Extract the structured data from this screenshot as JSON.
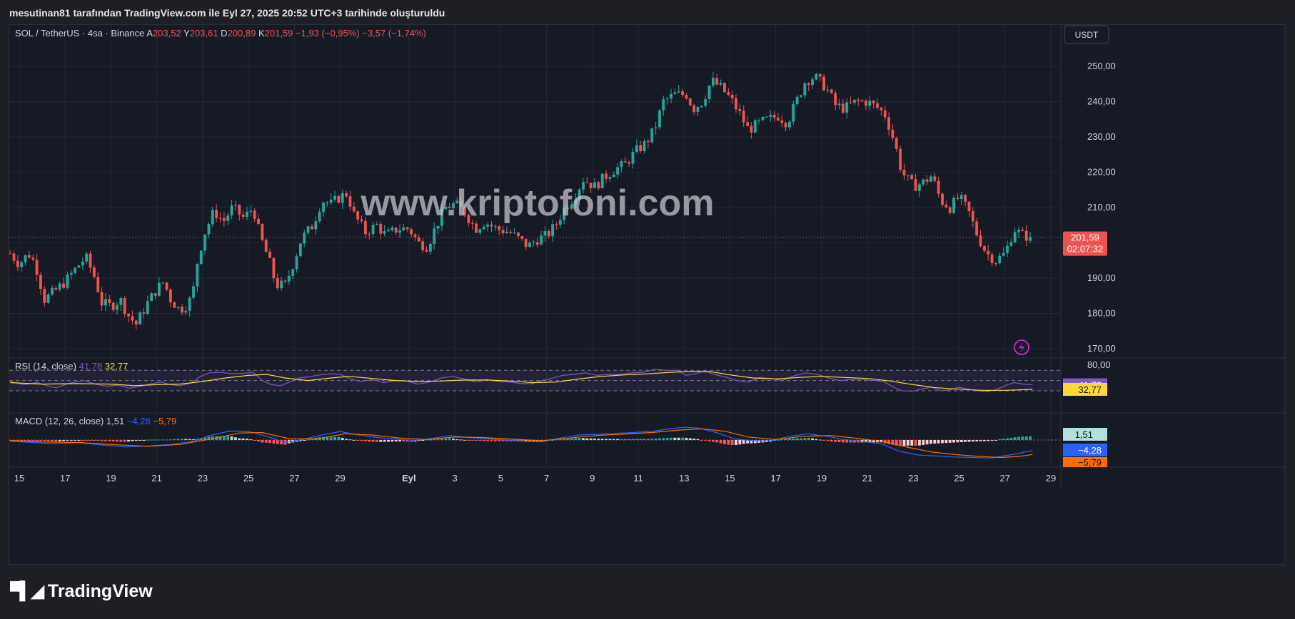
{
  "header": {
    "credit": "mesutinan81 tarafından TradingView.com ile Eyl 27, 2025 20:52 UTC+3 tarihinde oluşturuldu"
  },
  "legend": {
    "symbol": "SOL / TetherUS · 4sa · Binance",
    "open_label": "A",
    "open": "203,52",
    "high_label": "Y",
    "high": "203,61",
    "low_label": "D",
    "low": "200,89",
    "close_label": "K",
    "close": "201,59",
    "change": "−1,93 (−0,95%)",
    "change2": "−3,57 (−1,74%)"
  },
  "currency_button": "USDT",
  "price_label": {
    "value": "201,59",
    "countdown": "02:07:32"
  },
  "watermark": "www.kriptofoni.com",
  "rsi": {
    "label": "RSI (14, close)",
    "value": "41,78",
    "ma": "32,77",
    "scale_top": "80,00",
    "tag_value": "41,78",
    "tag_ma": "32,77"
  },
  "macd": {
    "label": "MACD (12, 26, close)",
    "hist": "1,51",
    "macd": "−4,28",
    "signal": "−5,79",
    "tag_hist": "1,51",
    "tag_macd": "−4,28",
    "tag_signal": "−5,79"
  },
  "footer": {
    "brand": "TradingView",
    "logo_icon": "tradingview-logo-icon"
  },
  "colors": {
    "up": "#26a69a",
    "down": "#ef5350",
    "bg": "#161a25",
    "rsi": "#7e57c2",
    "rsi_ma": "#fdd835",
    "macd": "#2962ff",
    "signal": "#ff6d00",
    "hist_up_strong": "#26a69a",
    "hist_up_weak": "#b2dfdb",
    "hist_down_strong": "#ff5252",
    "hist_down_weak": "#ffcdd2"
  },
  "chart_data": {
    "type": "candlestick",
    "price_axis": {
      "min": 165,
      "max": 255,
      "ticks": [
        "250,00",
        "240,00",
        "230,00",
        "220,00",
        "210,00",
        "190,00",
        "180,00",
        "170,00"
      ],
      "tick_values": [
        250,
        240,
        230,
        220,
        210,
        190,
        180,
        170
      ]
    },
    "x_ticks": [
      "15",
      "17",
      "19",
      "21",
      "23",
      "25",
      "27",
      "29",
      "Eyl",
      "3",
      "5",
      "7",
      "9",
      "11",
      "13",
      "15",
      "17",
      "19",
      "21",
      "23",
      "25",
      "27",
      "29"
    ],
    "x_tick_days": [
      15,
      17,
      19,
      21,
      23,
      25,
      27,
      29,
      32,
      34,
      36,
      38,
      40,
      42,
      44,
      46,
      48,
      50,
      52,
      54,
      56,
      58,
      60
    ],
    "day_start": 14.6,
    "candles_per_day": 6,
    "last_price": 201.59,
    "price_path": [
      [
        14.6,
        197
      ],
      [
        15.0,
        194
      ],
      [
        15.4,
        197
      ],
      [
        15.7,
        194
      ],
      [
        16.1,
        184
      ],
      [
        16.5,
        186
      ],
      [
        17.0,
        189
      ],
      [
        17.5,
        193
      ],
      [
        17.9,
        196
      ],
      [
        18.3,
        190
      ],
      [
        18.6,
        183
      ],
      [
        19.0,
        182
      ],
      [
        19.4,
        184
      ],
      [
        19.8,
        179
      ],
      [
        20.1,
        177
      ],
      [
        20.6,
        183
      ],
      [
        21.0,
        187
      ],
      [
        21.3,
        189
      ],
      [
        21.6,
        184
      ],
      [
        22.0,
        181
      ],
      [
        22.4,
        183
      ],
      [
        22.6,
        187
      ],
      [
        22.8,
        196
      ],
      [
        23.1,
        203
      ],
      [
        23.5,
        209
      ],
      [
        23.9,
        206
      ],
      [
        24.3,
        210
      ],
      [
        24.8,
        207
      ],
      [
        25.2,
        210
      ],
      [
        25.5,
        202
      ],
      [
        25.9,
        195
      ],
      [
        26.2,
        188
      ],
      [
        26.6,
        188
      ],
      [
        27.0,
        195
      ],
      [
        27.3,
        201
      ],
      [
        27.8,
        205
      ],
      [
        28.2,
        212
      ],
      [
        28.6,
        211
      ],
      [
        29.0,
        213
      ],
      [
        29.3,
        214
      ],
      [
        29.6,
        208
      ],
      [
        30.1,
        203
      ],
      [
        30.6,
        205
      ],
      [
        31.0,
        202
      ],
      [
        31.5,
        204
      ],
      [
        32.0,
        204
      ],
      [
        32.4,
        200
      ],
      [
        32.8,
        199
      ],
      [
        33.2,
        205
      ],
      [
        33.6,
        210
      ],
      [
        34.0,
        211
      ],
      [
        34.4,
        209
      ],
      [
        34.9,
        204
      ],
      [
        35.3,
        206
      ],
      [
        35.8,
        204
      ],
      [
        36.4,
        203
      ],
      [
        36.8,
        201
      ],
      [
        37.2,
        199
      ],
      [
        37.6,
        201
      ],
      [
        38.0,
        202
      ],
      [
        38.4,
        205
      ],
      [
        38.8,
        210
      ],
      [
        39.2,
        213
      ],
      [
        39.6,
        218
      ],
      [
        40.1,
        216
      ],
      [
        40.6,
        219
      ],
      [
        41.0,
        221
      ],
      [
        41.4,
        222
      ],
      [
        41.9,
        226
      ],
      [
        42.3,
        228
      ],
      [
        42.7,
        232
      ],
      [
        43.1,
        240
      ],
      [
        43.6,
        242
      ],
      [
        44.1,
        242
      ],
      [
        44.4,
        238
      ],
      [
        44.8,
        240
      ],
      [
        45.2,
        246
      ],
      [
        45.6,
        244
      ],
      [
        46.0,
        241
      ],
      [
        46.4,
        237
      ],
      [
        46.8,
        232
      ],
      [
        47.3,
        234
      ],
      [
        47.7,
        235
      ],
      [
        48.1,
        236
      ],
      [
        48.5,
        234
      ],
      [
        48.9,
        240
      ],
      [
        49.3,
        246
      ],
      [
        49.7,
        247
      ],
      [
        50.2,
        244
      ],
      [
        50.6,
        239
      ],
      [
        51.0,
        238
      ],
      [
        51.5,
        240
      ],
      [
        52.0,
        240
      ],
      [
        52.5,
        238
      ],
      [
        52.8,
        236
      ],
      [
        53.2,
        228
      ],
      [
        53.5,
        220
      ],
      [
        54.0,
        216
      ],
      [
        54.4,
        217
      ],
      [
        54.8,
        219
      ],
      [
        55.2,
        212
      ],
      [
        55.6,
        210
      ],
      [
        56.0,
        213
      ],
      [
        56.4,
        209
      ],
      [
        56.8,
        202
      ],
      [
        57.2,
        197
      ],
      [
        57.6,
        195
      ],
      [
        58.0,
        197
      ],
      [
        58.4,
        204
      ],
      [
        58.8,
        202
      ],
      [
        59.2,
        201.59
      ]
    ],
    "rsi_axis": {
      "min": 20,
      "max": 85,
      "levels": [
        70,
        50,
        30
      ]
    },
    "rsi_series": [
      [
        14.6,
        48
      ],
      [
        15.2,
        42
      ],
      [
        15.8,
        46
      ],
      [
        16.2,
        40
      ],
      [
        16.6,
        36
      ],
      [
        17.2,
        45
      ],
      [
        17.8,
        50
      ],
      [
        18.3,
        43
      ],
      [
        18.8,
        39
      ],
      [
        19.3,
        41
      ],
      [
        19.8,
        35
      ],
      [
        20.3,
        39
      ],
      [
        20.8,
        44
      ],
      [
        21.2,
        47
      ],
      [
        21.6,
        42
      ],
      [
        22.0,
        40
      ],
      [
        22.5,
        45
      ],
      [
        22.9,
        58
      ],
      [
        23.3,
        65
      ],
      [
        23.8,
        66
      ],
      [
        24.3,
        63
      ],
      [
        24.8,
        64
      ],
      [
        25.2,
        66
      ],
      [
        25.6,
        50
      ],
      [
        26.0,
        42
      ],
      [
        26.4,
        40
      ],
      [
        26.8,
        47
      ],
      [
        27.2,
        55
      ],
      [
        27.6,
        57
      ],
      [
        28.1,
        61
      ],
      [
        28.6,
        63
      ],
      [
        29.0,
        62
      ],
      [
        29.4,
        54
      ],
      [
        29.9,
        48
      ],
      [
        30.4,
        52
      ],
      [
        30.9,
        46
      ],
      [
        31.4,
        50
      ],
      [
        31.9,
        49
      ],
      [
        32.4,
        43
      ],
      [
        32.9,
        47
      ],
      [
        33.4,
        55
      ],
      [
        33.9,
        58
      ],
      [
        34.4,
        53
      ],
      [
        34.9,
        47
      ],
      [
        35.4,
        52
      ],
      [
        35.9,
        48
      ],
      [
        36.4,
        47
      ],
      [
        36.9,
        44
      ],
      [
        37.4,
        44
      ],
      [
        37.8,
        50
      ],
      [
        38.2,
        54
      ],
      [
        38.7,
        60
      ],
      [
        39.2,
        62
      ],
      [
        39.7,
        65
      ],
      [
        40.2,
        60
      ],
      [
        40.7,
        62
      ],
      [
        41.2,
        62
      ],
      [
        41.7,
        65
      ],
      [
        42.2,
        66
      ],
      [
        42.7,
        72
      ],
      [
        43.2,
        70
      ],
      [
        43.7,
        70
      ],
      [
        44.1,
        60
      ],
      [
        44.5,
        63
      ],
      [
        44.9,
        69
      ],
      [
        45.3,
        62
      ],
      [
        45.8,
        57
      ],
      [
        46.3,
        50
      ],
      [
        46.8,
        47
      ],
      [
        47.3,
        56
      ],
      [
        47.8,
        54
      ],
      [
        48.3,
        50
      ],
      [
        48.8,
        59
      ],
      [
        49.3,
        65
      ],
      [
        49.8,
        62
      ],
      [
        50.3,
        55
      ],
      [
        50.8,
        50
      ],
      [
        51.3,
        52
      ],
      [
        51.8,
        52
      ],
      [
        52.3,
        50
      ],
      [
        52.7,
        48
      ],
      [
        53.1,
        38
      ],
      [
        53.5,
        30
      ],
      [
        54.0,
        29
      ],
      [
        54.4,
        34
      ],
      [
        54.8,
        37
      ],
      [
        55.2,
        30
      ],
      [
        55.6,
        32
      ],
      [
        56.0,
        37
      ],
      [
        56.4,
        33
      ],
      [
        56.8,
        30
      ],
      [
        57.2,
        28
      ],
      [
        57.6,
        32
      ],
      [
        58.0,
        40
      ],
      [
        58.4,
        46
      ],
      [
        58.8,
        43
      ],
      [
        59.2,
        41.78
      ]
    ],
    "rsi_ma_series": [
      [
        14.6,
        46
      ],
      [
        16.0,
        43
      ],
      [
        17.5,
        44
      ],
      [
        19.0,
        43
      ],
      [
        20.0,
        40
      ],
      [
        21.0,
        42
      ],
      [
        22.0,
        43
      ],
      [
        23.0,
        48
      ],
      [
        24.0,
        55
      ],
      [
        25.0,
        60
      ],
      [
        25.8,
        62
      ],
      [
        26.6,
        55
      ],
      [
        27.6,
        50
      ],
      [
        28.6,
        55
      ],
      [
        29.4,
        58
      ],
      [
        30.4,
        54
      ],
      [
        31.4,
        50
      ],
      [
        32.4,
        48
      ],
      [
        33.4,
        49
      ],
      [
        34.4,
        51
      ],
      [
        35.4,
        51
      ],
      [
        36.4,
        49
      ],
      [
        37.4,
        46
      ],
      [
        38.4,
        47
      ],
      [
        39.4,
        53
      ],
      [
        40.4,
        58
      ],
      [
        41.4,
        61
      ],
      [
        42.4,
        63
      ],
      [
        43.4,
        66
      ],
      [
        44.4,
        68
      ],
      [
        45.2,
        67
      ],
      [
        46.0,
        61
      ],
      [
        47.0,
        55
      ],
      [
        48.0,
        53
      ],
      [
        49.0,
        56
      ],
      [
        50.0,
        58
      ],
      [
        51.0,
        56
      ],
      [
        52.0,
        54
      ],
      [
        53.0,
        49
      ],
      [
        54.0,
        42
      ],
      [
        55.0,
        36
      ],
      [
        56.0,
        33
      ],
      [
        57.0,
        31
      ],
      [
        58.0,
        31
      ],
      [
        59.2,
        32.77
      ]
    ],
    "macd_axis": {
      "min": -8,
      "max": 6
    },
    "macd_series": [
      [
        14.6,
        -0.5
      ],
      [
        15.6,
        -1.0
      ],
      [
        16.6,
        -1.5
      ],
      [
        17.6,
        -1.0
      ],
      [
        18.6,
        -2.0
      ],
      [
        19.6,
        -2.8
      ],
      [
        20.6,
        -2.4
      ],
      [
        21.6,
        -1.8
      ],
      [
        22.6,
        -0.5
      ],
      [
        23.4,
        2.0
      ],
      [
        24.2,
        3.6
      ],
      [
        25.0,
        3.4
      ],
      [
        25.8,
        1.5
      ],
      [
        26.6,
        -1.0
      ],
      [
        27.4,
        0.3
      ],
      [
        28.2,
        2.0
      ],
      [
        29.0,
        3.4
      ],
      [
        29.8,
        2.0
      ],
      [
        30.6,
        1.0
      ],
      [
        31.4,
        0.4
      ],
      [
        32.2,
        -0.2
      ],
      [
        33.0,
        0.6
      ],
      [
        33.8,
        1.8
      ],
      [
        34.6,
        1.0
      ],
      [
        35.4,
        0.5
      ],
      [
        36.2,
        0.0
      ],
      [
        37.0,
        -0.5
      ],
      [
        37.8,
        -0.8
      ],
      [
        38.6,
        0.8
      ],
      [
        39.4,
        2.0
      ],
      [
        40.2,
        2.3
      ],
      [
        41.0,
        2.6
      ],
      [
        41.8,
        3.0
      ],
      [
        42.6,
        3.5
      ],
      [
        43.4,
        4.6
      ],
      [
        44.0,
        5.1
      ],
      [
        44.6,
        4.8
      ],
      [
        45.4,
        3.0
      ],
      [
        46.2,
        0.5
      ],
      [
        47.0,
        -0.3
      ],
      [
        47.8,
        -0.3
      ],
      [
        48.6,
        1.5
      ],
      [
        49.4,
        2.5
      ],
      [
        50.2,
        1.5
      ],
      [
        51.0,
        0.2
      ],
      [
        51.8,
        -0.6
      ],
      [
        52.6,
        -1.5
      ],
      [
        53.4,
        -4.5
      ],
      [
        54.2,
        -6.0
      ],
      [
        55.0,
        -6.4
      ],
      [
        55.8,
        -6.8
      ],
      [
        56.6,
        -7.0
      ],
      [
        57.4,
        -7.2
      ],
      [
        58.2,
        -6.0
      ],
      [
        59.2,
        -4.28
      ]
    ],
    "signal_series": [
      [
        14.6,
        -0.2
      ],
      [
        16.0,
        -0.8
      ],
      [
        17.6,
        -1.0
      ],
      [
        19.0,
        -1.8
      ],
      [
        20.6,
        -2.5
      ],
      [
        22.0,
        -1.8
      ],
      [
        23.4,
        0.5
      ],
      [
        24.6,
        2.8
      ],
      [
        25.6,
        3.0
      ],
      [
        26.8,
        0.5
      ],
      [
        28.0,
        0.5
      ],
      [
        29.2,
        2.5
      ],
      [
        30.4,
        2.0
      ],
      [
        31.6,
        0.8
      ],
      [
        32.8,
        0.2
      ],
      [
        34.0,
        1.2
      ],
      [
        35.2,
        1.0
      ],
      [
        36.4,
        0.4
      ],
      [
        37.8,
        -0.3
      ],
      [
        39.0,
        0.8
      ],
      [
        40.2,
        1.8
      ],
      [
        41.4,
        2.4
      ],
      [
        42.6,
        3.0
      ],
      [
        43.8,
        4.0
      ],
      [
        44.8,
        4.5
      ],
      [
        45.8,
        3.5
      ],
      [
        46.8,
        1.2
      ],
      [
        48.0,
        0.2
      ],
      [
        49.2,
        1.5
      ],
      [
        50.4,
        1.8
      ],
      [
        51.6,
        0.6
      ],
      [
        52.8,
        -0.8
      ],
      [
        53.8,
        -3.0
      ],
      [
        54.8,
        -4.8
      ],
      [
        55.8,
        -5.8
      ],
      [
        56.8,
        -6.5
      ],
      [
        57.8,
        -7.0
      ],
      [
        58.6,
        -6.6
      ],
      [
        59.2,
        -5.79
      ]
    ]
  }
}
